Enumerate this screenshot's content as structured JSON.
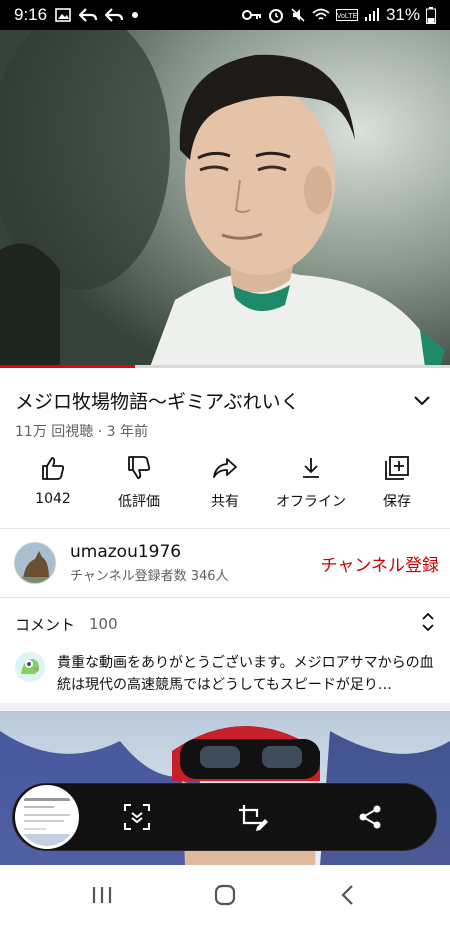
{
  "status_bar": {
    "time": "9:16",
    "battery": "31%"
  },
  "player": {
    "progress_fraction": 0.3
  },
  "video": {
    "title": "メジロ牧場物語～ギミアぶれいく",
    "meta": "11万 回視聴 · 3 年前"
  },
  "actions": {
    "like": "1042",
    "dislike": "低評価",
    "share": "共有",
    "offline": "オフライン",
    "save": "保存"
  },
  "channel": {
    "name": "umazou1976",
    "subscribers": "チャンネル登録者数 346人",
    "subscribe_label": "チャンネル登録"
  },
  "comments": {
    "label": "コメント",
    "count": "100",
    "top_comment": "貴重な動画をありがとうございます。メジロアサマからの血統は現代の高速競馬ではどうしてもスピードが足り…"
  },
  "colors": {
    "accent": "#cc0000",
    "progress": "#ee0000"
  }
}
